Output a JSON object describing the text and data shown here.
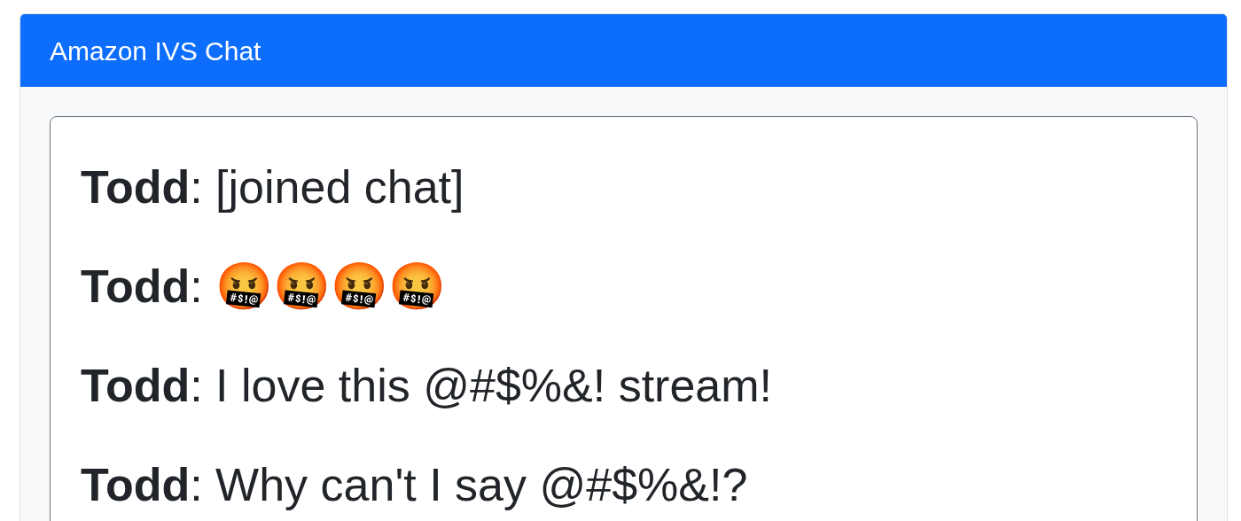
{
  "header": {
    "title": "Amazon IVS Chat"
  },
  "messages": [
    {
      "kind": "text",
      "author": "Todd",
      "text": ": [joined chat]"
    },
    {
      "kind": "emoji",
      "author": "Todd",
      "text": ": ",
      "emojis": "🤬🤬🤬🤬"
    },
    {
      "kind": "text",
      "author": "Todd",
      "text": ": I love this @#$%&! stream!"
    },
    {
      "kind": "text",
      "author": "Todd",
      "text": ": Why can't I say @#$%&!?"
    }
  ]
}
